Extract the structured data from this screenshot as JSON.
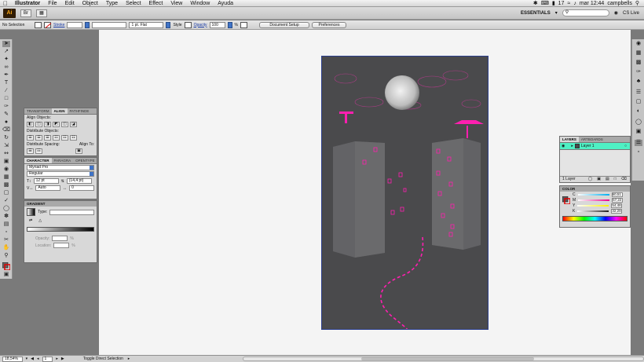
{
  "menubar": {
    "apple": "",
    "items": [
      "Illustrator",
      "File",
      "Edit",
      "Object",
      "Type",
      "Select",
      "Effect",
      "View",
      "Window",
      "Ayuda"
    ],
    "battery": "17",
    "clock": "mar 12:44",
    "user": "campbells"
  },
  "appbar": {
    "logo": "Ai",
    "workspace": "ESSENTIALS",
    "cslive": "CS Live"
  },
  "control": {
    "selection": "No Selection",
    "stroke_label": "Stroke",
    "stroke_profile": "1 pt. Flat",
    "style_label": "Style",
    "opacity_label": "Opacity",
    "opacity_value": "100",
    "percent": "%",
    "document_setup": "Document Setup",
    "preferences": "Preferences"
  },
  "align_panel": {
    "tabs": [
      "TRANSFORM",
      "ALIGN",
      "PATHFINDE"
    ],
    "align_objects": "Align Objects:",
    "distribute_objects": "Distribute Objects:",
    "distribute_spacing": "Distribute Spacing:",
    "align_to": "Align To:"
  },
  "character_panel": {
    "tabs": [
      "CHARACTER",
      "PARAGRA",
      "OPENTYPE"
    ],
    "font": "Myriad Pro",
    "style": "Regular",
    "size": "12 pt",
    "leading": "(14,4 pt)",
    "kerning": "Auto",
    "tracking": "0"
  },
  "gradient_panel": {
    "title": "GRADIENT",
    "type_label": "Type:",
    "opacity_label": "Opacity:",
    "location_label": "Location:",
    "percent": "%"
  },
  "layers_panel": {
    "tabs": [
      "LAYERS",
      "ARTBOARDS"
    ],
    "layer_name": "Layer 1",
    "footer": "1 Layer"
  },
  "color_panel": {
    "title": "COLOR",
    "channels": [
      {
        "label": "C",
        "value": "60,51",
        "color": "#00aeef"
      },
      {
        "label": "M",
        "value": "57,22",
        "color": "#ec008c"
      },
      {
        "label": "Y",
        "value": "54,48",
        "color": "#fff200"
      },
      {
        "label": "K",
        "value": "32,29",
        "color": "#231f20"
      }
    ]
  },
  "status": {
    "zoom": "18,54%",
    "page": "1",
    "tool_hint": "Toggle Direct Selection"
  },
  "colors": {
    "accent": "#ff00a8",
    "artboard": "#4a4a4c",
    "layer_highlight": "#4ff0c4"
  }
}
